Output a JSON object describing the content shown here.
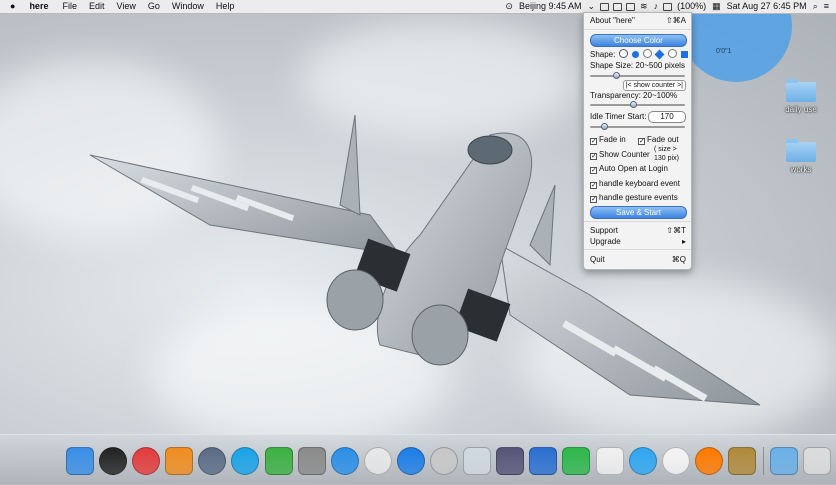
{
  "menubar": {
    "app_name": "here",
    "menus": [
      "File",
      "Edit",
      "View",
      "Go",
      "Window",
      "Help"
    ],
    "clock_city": "Beijing 9:45 AM",
    "battery": "(100%)",
    "date_time": "Sat Aug 27  6:45 PM"
  },
  "overlay": {
    "circle_text": "0'0\"1",
    "circle_color": "#4da0e8"
  },
  "desktop": {
    "folders": [
      {
        "label": "daily use"
      },
      {
        "label": "works"
      }
    ]
  },
  "menu": {
    "about": "About \"here\"",
    "about_shortcut": "⇧⌘A",
    "choose_color": "Choose Color",
    "shape_label": "Shape:",
    "shape_size_label": "Shape Size: 20~500 pixels",
    "shape_size_value": 0.26,
    "show_counter_button": "|< show counter >|",
    "transparency_label": "Transparency: 20~100%",
    "transparency_value": 0.46,
    "idle_timer_label": "Idle Timer Start:",
    "idle_timer_value": "170",
    "idle_timer_slider": 0.12,
    "fade_in": "Fade in",
    "fade_out": "Fade out",
    "show_counter": "Show Counter",
    "size_note_1": "( size >",
    "size_note_2": "130 pix)",
    "auto_open": "Auto Open at Login",
    "handle_keyboard": "handle keyboard event",
    "handle_gesture": "handle gesture events",
    "save_start": "Save & Start",
    "support": "Support",
    "support_shortcut": "⇧⌘T",
    "upgrade": "Upgrade",
    "quit": "Quit",
    "quit_shortcut": "⌘Q"
  },
  "dock": {
    "apps": [
      "finder-icon",
      "dashboard-icon",
      "music-icon",
      "ibooks-icon",
      "launchpad-icon",
      "skype-icon",
      "facetime-icon",
      "system-preferences-icon",
      "safari-icon",
      "chrome-icon",
      "app-store-icon",
      "disk-utility-icon",
      "preview-icon",
      "script-editor-icon",
      "xcode-icon",
      "numbers-icon",
      "here-app-icon",
      "messages-icon",
      "photos-icon",
      "qq-icon",
      "stack-icon",
      "downloads-icon",
      "trash-icon"
    ],
    "colors": [
      "#3a8ee6",
      "#222222",
      "#e33b3b",
      "#f08c1e",
      "#5b6b85",
      "#1aa3e8",
      "#3cb043",
      "#8a8a8a",
      "#2a8fe8",
      "#e8e8e8",
      "#1c7ee6",
      "#c8c8c8",
      "#d0d8e0",
      "#555577",
      "#2a6fd1",
      "#2db84b",
      "#f0f0f0",
      "#2ea7f2",
      "#f4f4f4",
      "#ff7a00",
      "#b08a3a",
      "#6ab0e8",
      "#dcdcdc"
    ]
  }
}
